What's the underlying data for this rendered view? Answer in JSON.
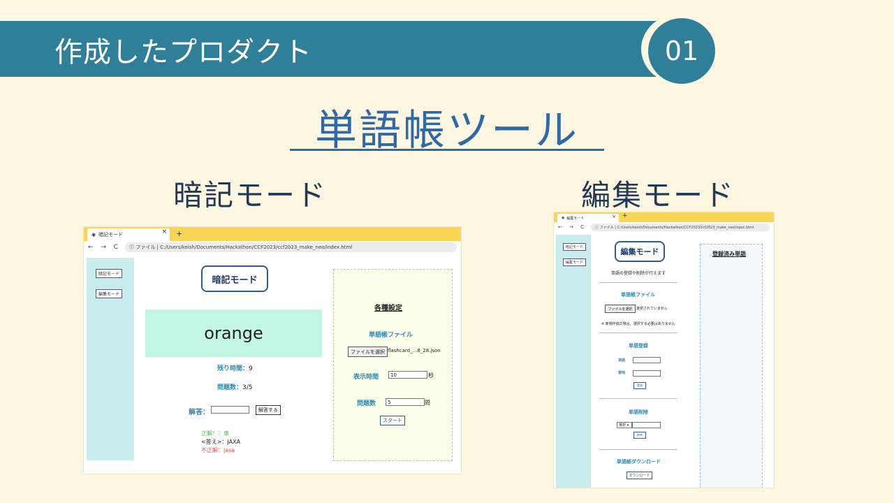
{
  "slide": {
    "header_title": "作成したプロダクト",
    "number": "01",
    "main_title": "単語帳ツール",
    "left_label": "暗記モード",
    "right_label": "編集モード"
  },
  "memorize_shot": {
    "tab_title": "暗記モード",
    "tab_close": "×",
    "tab_new": "+",
    "nav": "←  →  C",
    "url": "ⓘ ファイル  |  C:/Users/keish/Documents/Hackathon/CCF2023/ccf2023_make_neo/index.html",
    "sidebar": [
      "暗記モード",
      "編集モード"
    ],
    "badge": "暗記モード",
    "word": "orange",
    "remaining_label": "残り時間：",
    "remaining_value": "9",
    "count_label": "問題数：",
    "count_value": "3/5",
    "answer_label": "解答：",
    "answer_button": "解答する",
    "correct": "正解！：車",
    "answer_line": "<答え>：JAXA",
    "wrong": "不正解：jasa",
    "settings": {
      "title": "各種設定",
      "file_label": "単語帳ファイル",
      "file_button": "ファイルを選択",
      "file_name": "flashcard_...8_28.json",
      "time_label": "表示時間",
      "time_value": "10",
      "time_unit": "秒",
      "qcount_label": "問題数",
      "qcount_value": "5",
      "qcount_unit": "問",
      "start_button": "スタート"
    }
  },
  "edit_shot": {
    "tab_title": "編集モード",
    "tab_close": "×",
    "tab_new": "+",
    "nav": "←  →  C",
    "url": "ⓘ ファイル  |  C:/Users/keish/Documents/Hackathon/CCF2023/ccf2023_make_neo/input.html",
    "sidebar": [
      "暗記モード",
      "編集モード"
    ],
    "badge": "編集モード",
    "subtitle": "単語の登録や削除が行えます",
    "file_section": "単語帳ファイル",
    "file_button": "ファイルを選択",
    "file_status": "選択されていません",
    "file_note": "※ 新規作成の場合、選択する必要はありません",
    "register_section": "単語登録",
    "word_label": "単語",
    "meaning_label": "意味",
    "register_button": "登録",
    "delete_section": "単語削除",
    "select_value": "選択 ▾",
    "delete_button": "削除",
    "download_section": "単語帳ダウンロード",
    "download_button": "ダウンロード",
    "registered_title": "登録済み単語"
  }
}
